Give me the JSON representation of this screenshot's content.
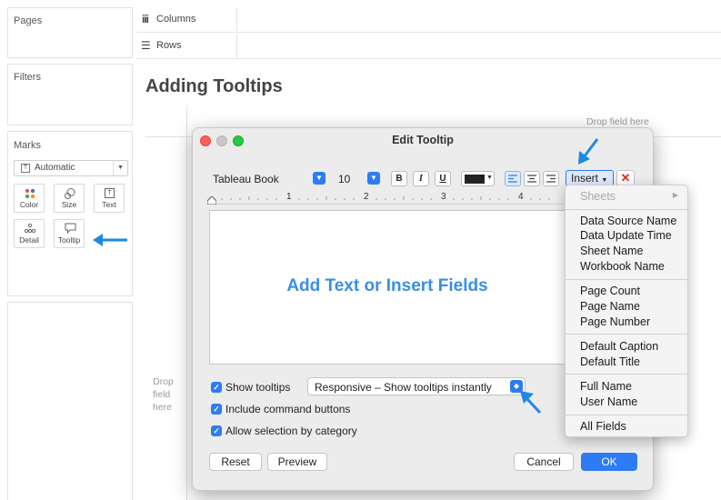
{
  "left_panel": {
    "pages_title": "Pages",
    "filters_title": "Filters",
    "marks_title": "Marks",
    "mark_type": "Automatic",
    "mark_cards": [
      {
        "label": "Color",
        "icon": "color-icon"
      },
      {
        "label": "Size",
        "icon": "size-icon"
      },
      {
        "label": "Text",
        "icon": "text-icon"
      },
      {
        "label": "Detail",
        "icon": "detail-icon"
      },
      {
        "label": "Tooltip",
        "icon": "tooltip-icon"
      }
    ]
  },
  "shelves": {
    "columns": "Columns",
    "rows": "Rows"
  },
  "view": {
    "title": "Adding Tooltips",
    "drop_field_top": "Drop field here",
    "drop_field_left_1": "Drop",
    "drop_field_left_2": "field",
    "drop_field_left_3": "here"
  },
  "dialog": {
    "title": "Edit Tooltip",
    "font_name": "Tableau Book",
    "font_size": "10",
    "bold": "B",
    "italic": "I",
    "underline": "U",
    "insert_label": "Insert",
    "ruler_1": "1",
    "ruler_2": "2",
    "ruler_3": "3",
    "ruler_4": "4",
    "placeholder": "Add Text or Insert Fields",
    "show_tooltips": "Show tooltips",
    "tooltip_mode": "Responsive – Show tooltips instantly",
    "include_command_buttons": "Include command buttons",
    "allow_selection": "Allow selection by category",
    "reset": "Reset",
    "preview": "Preview",
    "cancel": "Cancel",
    "ok": "OK"
  },
  "insert_menu": {
    "sheets": "Sheets",
    "group1": [
      "Data Source Name",
      "Data Update Time",
      "Sheet Name",
      "Workbook Name"
    ],
    "group2": [
      "Page Count",
      "Page Name",
      "Page Number"
    ],
    "group3": [
      "Default Caption",
      "Default Title"
    ],
    "group4": [
      "Full Name",
      "User Name"
    ],
    "group5": [
      "All Fields"
    ]
  },
  "colors": {
    "accent": "#2d7cf6",
    "annotation_arrow": "#1e88e5",
    "placeholder_text": "#3a8ee6"
  }
}
